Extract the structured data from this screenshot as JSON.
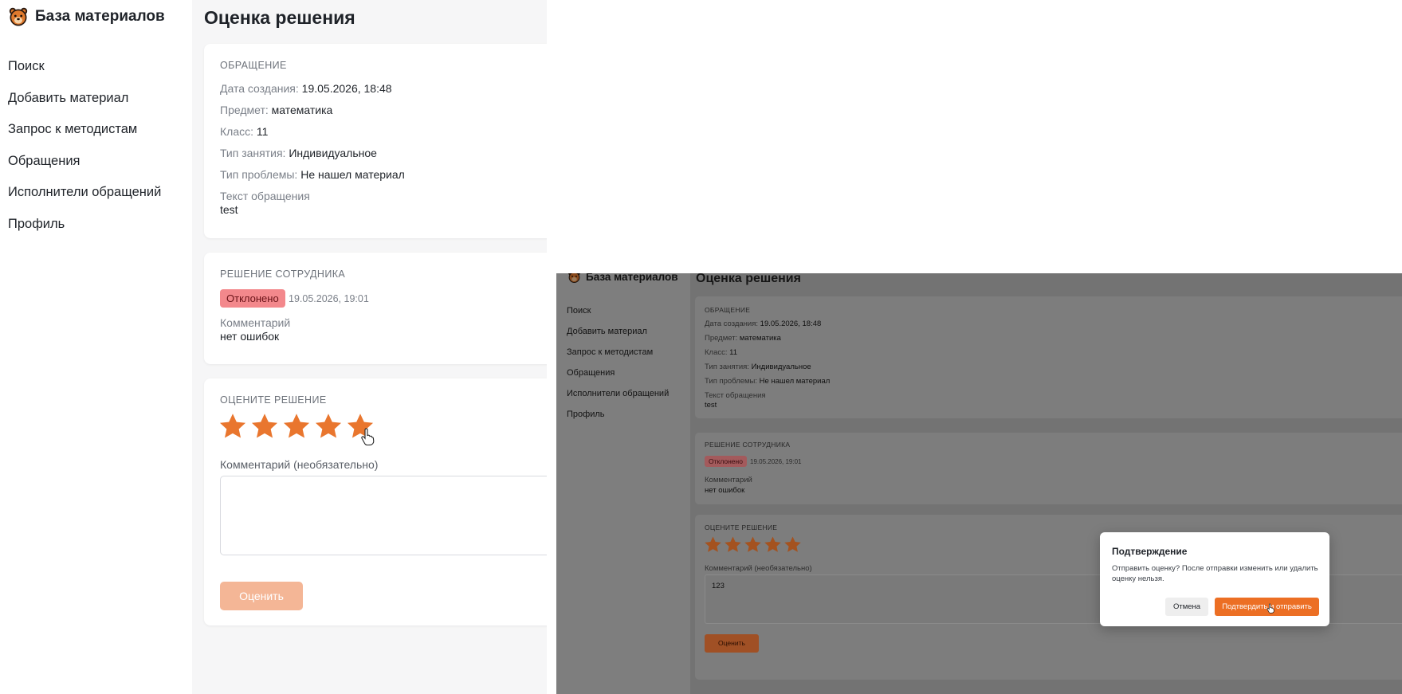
{
  "app": {
    "brand": "База материалов"
  },
  "page": {
    "title": "Оценка решения"
  },
  "nav": {
    "items": [
      "Поиск",
      "Добавить материал",
      "Запрос к методистам",
      "Обращения",
      "Исполнители обращений",
      "Профиль"
    ]
  },
  "request": {
    "section": "ОБРАЩЕНИЕ",
    "created_label": "Дата создания:",
    "created_value": "19.05.2026, 18:48",
    "subject_label": "Предмет:",
    "subject_value": "математика",
    "class_label": "Класс:",
    "class_value": "11",
    "lesson_label": "Тип занятия:",
    "lesson_value": "Индивидуальное",
    "problem_label": "Тип проблемы:",
    "problem_value": "Не нашел материал",
    "text_label": "Текст обращения",
    "text_value": "test"
  },
  "decision": {
    "section": "РЕШЕНИЕ СОТРУДНИКА",
    "status": "Отклонено",
    "date": "19.05.2026, 19:01",
    "comment_label": "Комментарий",
    "comment_value": "нет ошибок"
  },
  "rating": {
    "section": "ОЦЕНИТЕ РЕШЕНИЕ",
    "stars_selected": 5,
    "stars_total": 5,
    "comment_label": "Комментарий (необязательно)",
    "comment_value_left": "",
    "comment_value_right": "123",
    "submit_label": "Оценить"
  },
  "modal": {
    "title": "Подтверждение",
    "text": "Отправить оценку? После отправки изменить или удалить оценку нельзя.",
    "cancel_label": "Отмена",
    "confirm_label": "Подтвердить и отправить"
  },
  "colors": {
    "accent": "#ec6f24",
    "star": "#e9762e",
    "badge_rejected": "#f3888c",
    "button_disabled": "#f4b696",
    "overlay": "#737373"
  },
  "icons": {
    "logo": "bear-head-icon",
    "star": "star-icon",
    "cursor": "hand-pointer-icon"
  }
}
